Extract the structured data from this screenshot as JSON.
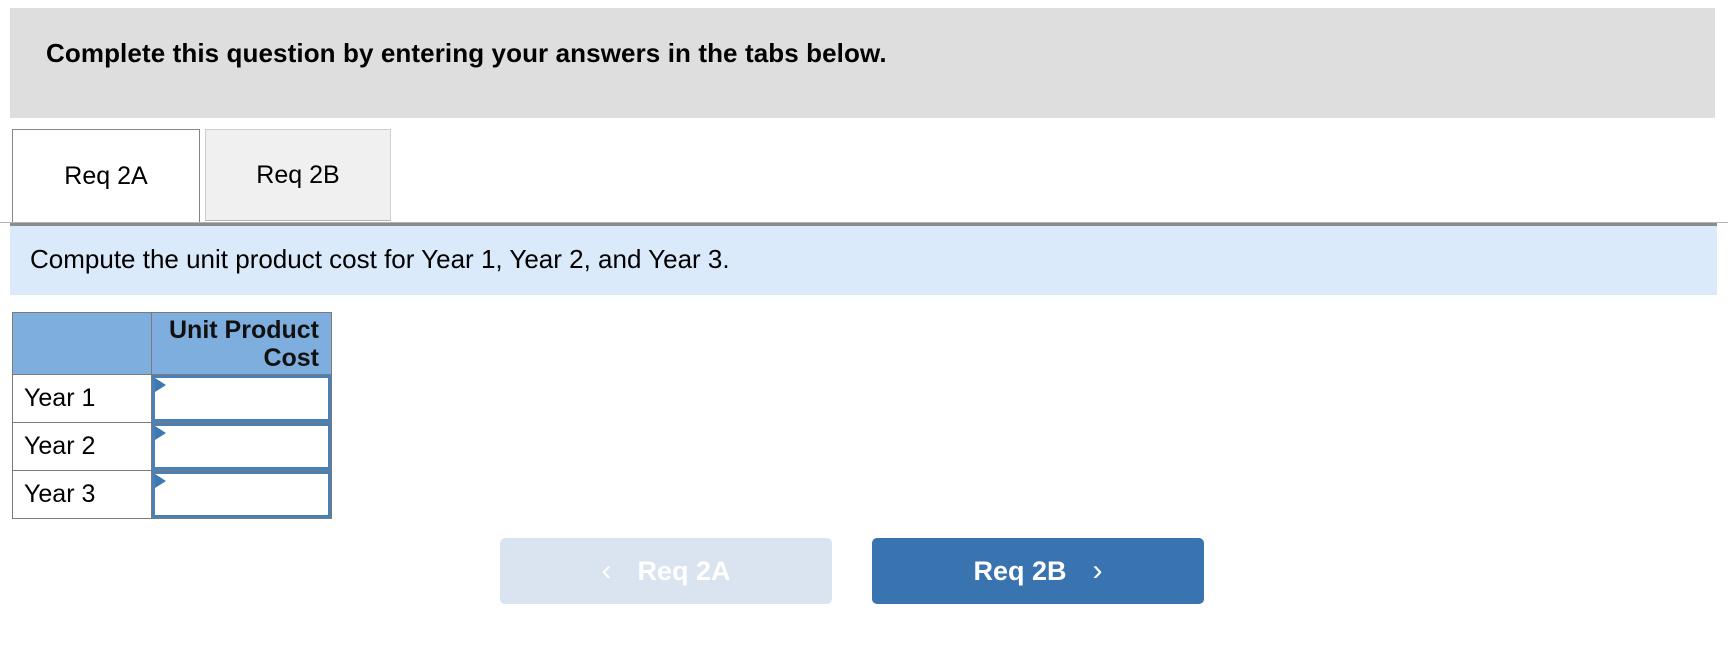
{
  "instruction": {
    "text": "Complete this question by entering your answers in the tabs below.",
    "background_color": "#dedede"
  },
  "tabs": [
    {
      "label": "Req 2A",
      "active": true
    },
    {
      "label": "Req 2B",
      "active": false
    }
  ],
  "requirement": {
    "prompt": "Compute the unit product cost for Year 1, Year 2, and Year 3.",
    "background_color": "#daeafa"
  },
  "table": {
    "header_background_color": "#7eaede",
    "columns": [
      "",
      "Unit Product Cost"
    ],
    "header_line_1": "Unit Product",
    "header_line_2": "Cost",
    "rows": [
      {
        "label": "Year 1",
        "value": "",
        "placeholder": ""
      },
      {
        "label": "Year 2",
        "value": "",
        "placeholder": ""
      },
      {
        "label": "Year 3",
        "value": "",
        "placeholder": ""
      }
    ],
    "input_border_color": "#4a80b8",
    "marker_icon": "triangle-right-icon"
  },
  "navigation": {
    "prev": {
      "label": "Req 2A",
      "icon": "chevron-left-icon",
      "glyph": "‹",
      "disabled": true,
      "background_color": "#dae3f0"
    },
    "next": {
      "label": "Req 2B",
      "icon": "chevron-right-icon",
      "glyph": "›",
      "disabled": false,
      "background_color": "#3973b0"
    }
  }
}
